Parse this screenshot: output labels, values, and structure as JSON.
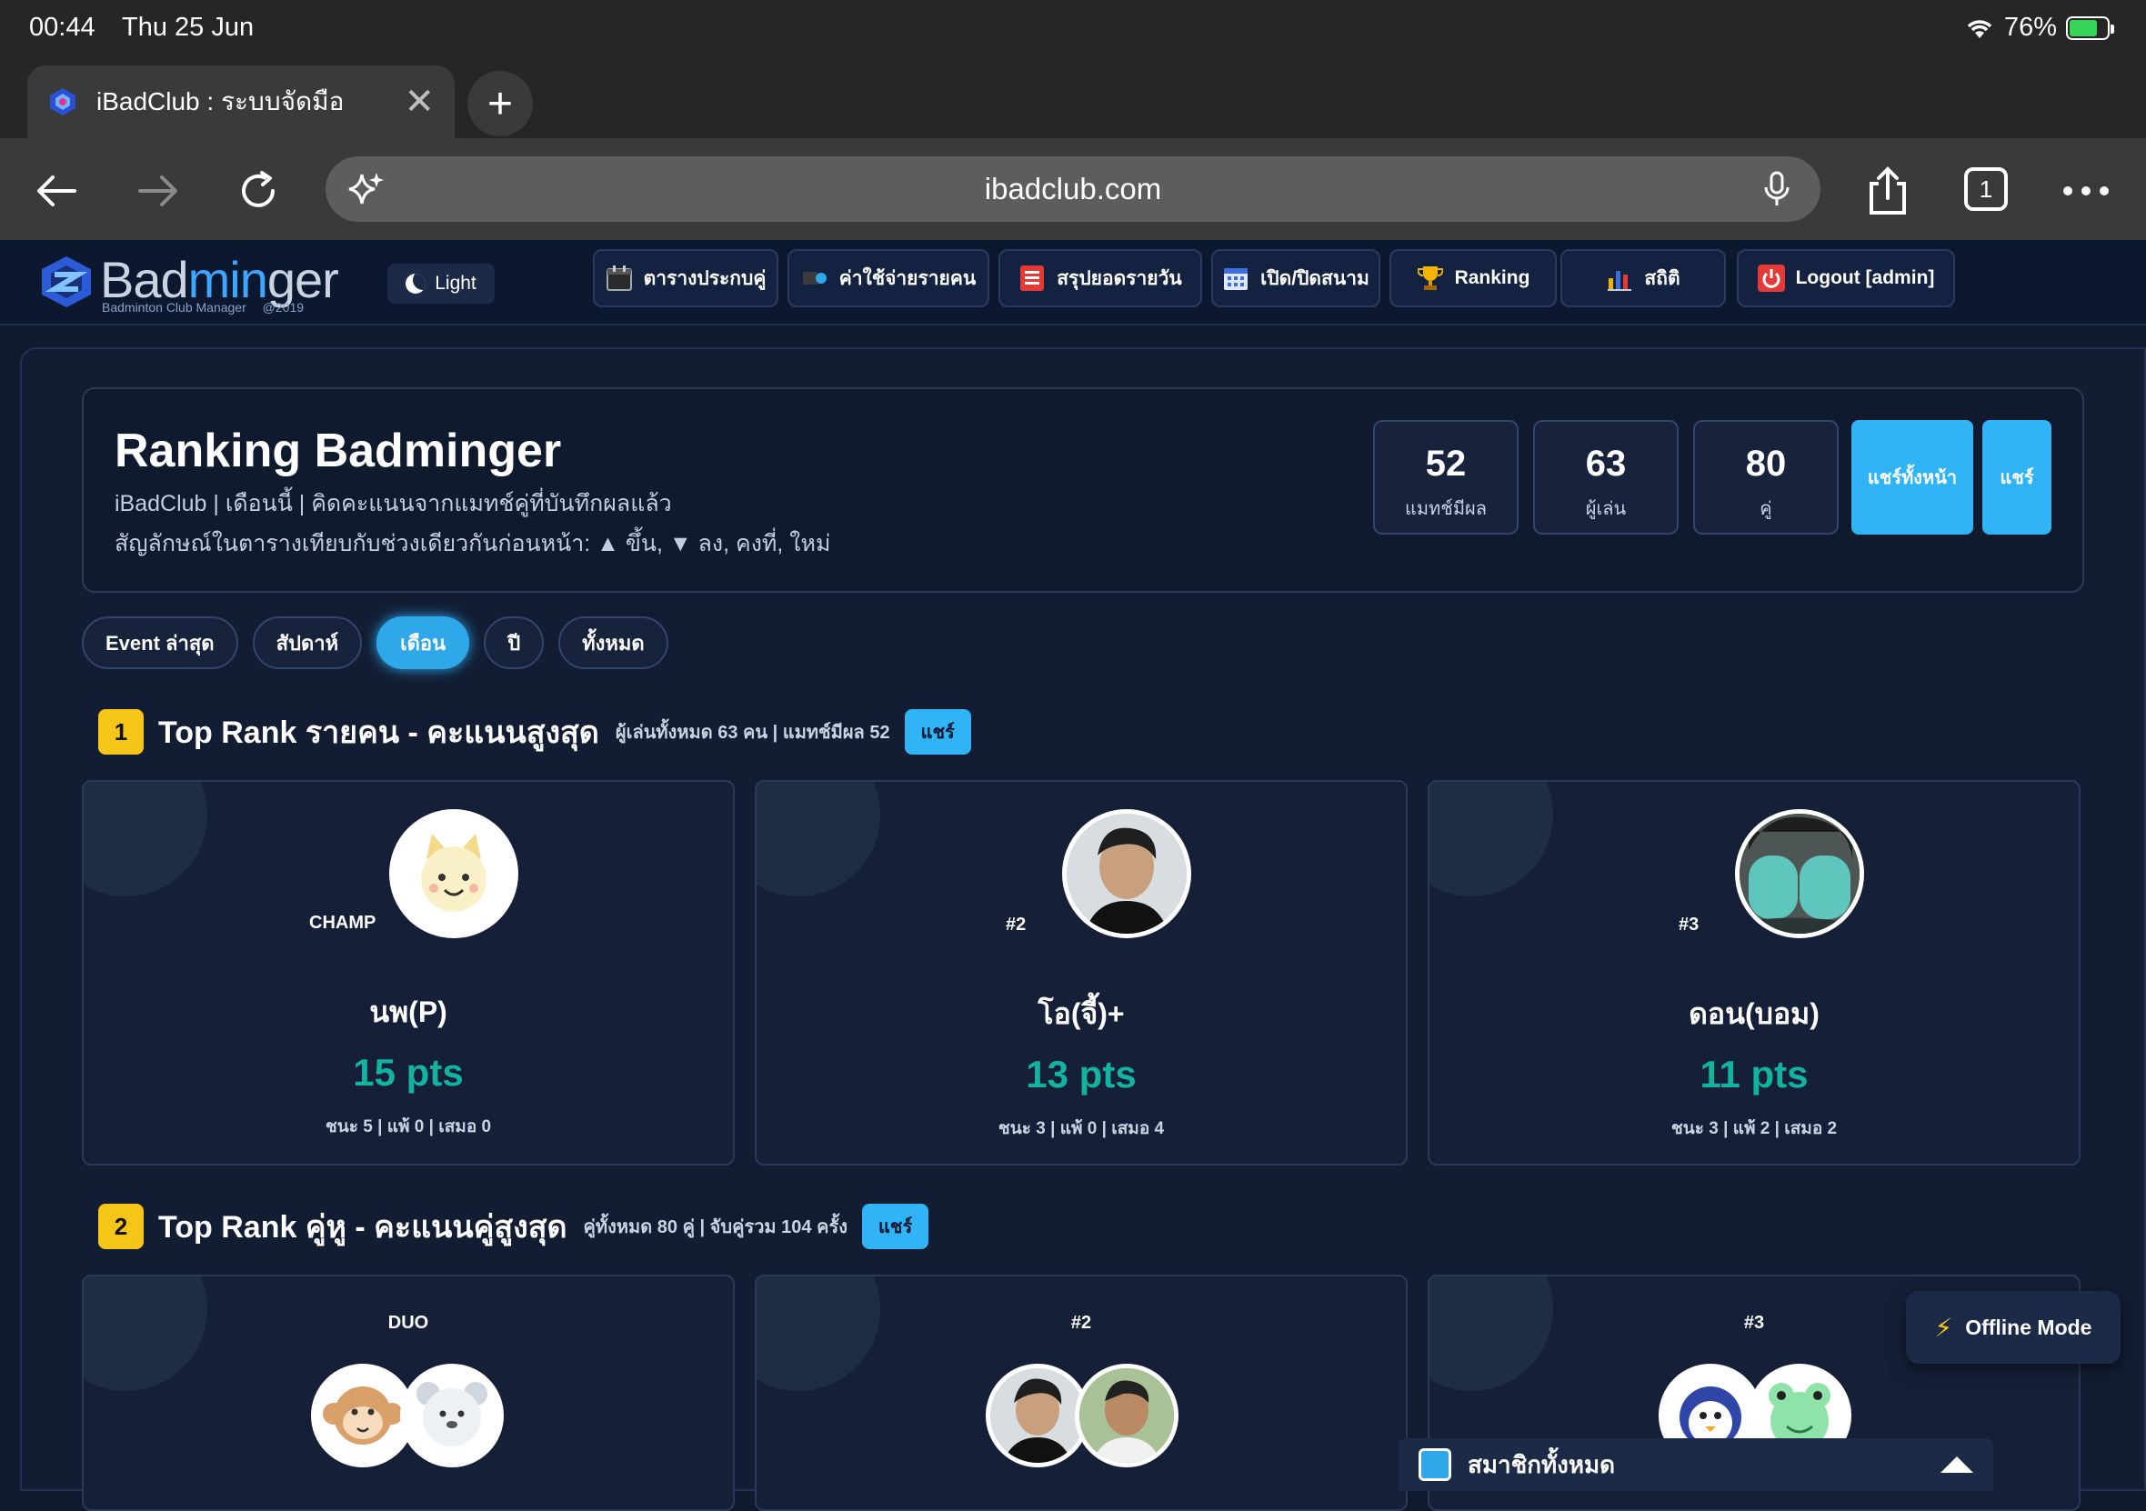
{
  "status": {
    "time": "00:44",
    "date": "Thu 25 Jun",
    "battery": "76%"
  },
  "browser": {
    "tab_title": "iBadClub : ระบบจัดมือ",
    "url": "ibadclub.com",
    "tab_count": "1"
  },
  "app": {
    "brand": {
      "prefix": "Bad",
      "highlight": "min",
      "suffix": "ger",
      "tagline": "Badminton Club Manager",
      "year": "@2019"
    },
    "theme_label": "Light",
    "nav": [
      {
        "label": "ตารางประกบคู่",
        "icon": "calendar-icon"
      },
      {
        "label": "ค่าใช้จ่ายรายคน",
        "icon": "shuttlecock-icon"
      },
      {
        "label": "สรุปยอดรายวัน",
        "icon": "list-icon"
      },
      {
        "label": "เปิด/ปิดสนาม",
        "icon": "calendar-grid-icon"
      },
      {
        "label": "Ranking",
        "icon": "trophy-icon"
      },
      {
        "label": "สถิติ",
        "icon": "bar-chart-icon"
      },
      {
        "label": "Logout [admin]",
        "icon": "power-icon"
      }
    ]
  },
  "hero": {
    "title": "Ranking Badminger",
    "subtitle1": "iBadClub | เดือนนี้ | คิดคะแนนจากแมทช์คู่ที่บันทึกผลแล้ว",
    "subtitle2": "สัญลักษณ์ในตารางเทียบกับช่วงเดียวกันก่อนหน้า: ▲ ขึ้น, ▼ ลง, คงที่, ใหม่",
    "stats": [
      {
        "value": "52",
        "label": "แมทช์มีผล"
      },
      {
        "value": "63",
        "label": "ผู้เล่น"
      },
      {
        "value": "80",
        "label": "คู่"
      }
    ],
    "share_all": "แชร์ทั้งหน้า",
    "share": "แชร์"
  },
  "filters": [
    "Event ล่าสุด",
    "สัปดาห์",
    "เดือน",
    "ปี",
    "ทั้งหมด"
  ],
  "active_filter": "เดือน",
  "section1": {
    "num": "1",
    "title": "Top Rank รายคน - คะแนนสูงสุด",
    "meta": "ผู้เล่นทั้งหมด 63 คน | แมทช์มีผล 52",
    "share": "แชร์",
    "cards": [
      {
        "rank": "CHAMP",
        "name": "นพ(P)",
        "pts": "15 pts",
        "record": "ชนะ 5 | แพ้ 0 | เสมอ 0"
      },
      {
        "rank": "#2",
        "name": "โอ(จี้)+",
        "pts": "13 pts",
        "record": "ชนะ 3 | แพ้ 0 | เสมอ 4"
      },
      {
        "rank": "#3",
        "name": "ดอน(บอม)",
        "pts": "11 pts",
        "record": "ชนะ 3 | แพ้ 2 | เสมอ 2"
      }
    ]
  },
  "section2": {
    "num": "2",
    "title": "Top Rank คู่หู - คะแนนคู่สูงสุด",
    "meta": "คู่ทั้งหมด 80 คู่ | จับคู่รวม 104 ครั้ง",
    "share": "แชร์",
    "cards": [
      {
        "rank": "DUO"
      },
      {
        "rank": "#2"
      },
      {
        "rank": "#3"
      }
    ]
  },
  "offline": "Offline Mode",
  "members": "สมาชิกทั้งหมด",
  "colors": {
    "accent": "#31b4f5",
    "points": "#14b3a0",
    "badge": "#f5c518",
    "bg": "#121d33"
  }
}
